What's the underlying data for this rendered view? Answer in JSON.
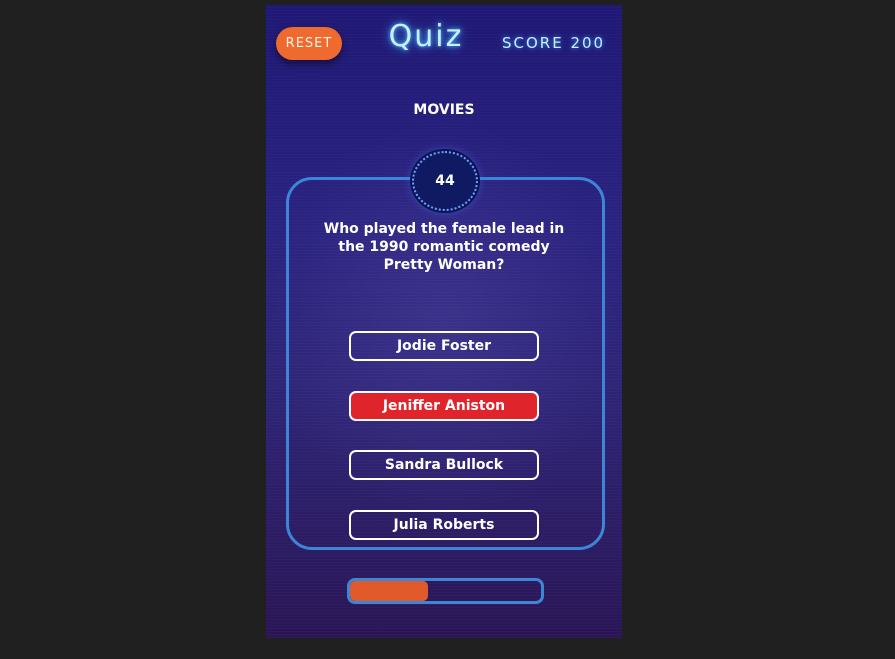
{
  "header": {
    "reset_label": "RESET",
    "title": "Quiz",
    "score_label": "SCORE 200"
  },
  "category": "MOVIES",
  "timer": "44",
  "question": "Who played the female lead in the 1990 romantic comedy Pretty Woman?",
  "answers": [
    {
      "label": "Jodie Foster",
      "state": "default"
    },
    {
      "label": "Jeniffer Aniston",
      "state": "wrong"
    },
    {
      "label": "Sandra Bullock",
      "state": "default"
    },
    {
      "label": "Julia Roberts",
      "state": "default"
    }
  ],
  "progress": {
    "fraction": 0.41
  },
  "colors": {
    "accent": "#ee6a2e",
    "wrong": "#e0242c",
    "border": "#3d86d6",
    "progress_fill": "#e05a2c"
  }
}
